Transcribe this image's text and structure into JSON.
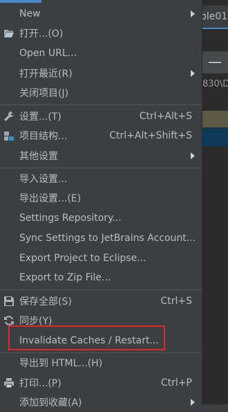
{
  "background": {
    "tab_label": "ple01",
    "path_fragment": "830\\D"
  },
  "menu": {
    "items": [
      {
        "label": "New",
        "shortcut": "",
        "submenu": true
      },
      {
        "label": "打开...(O)",
        "shortcut": "",
        "submenu": false,
        "icon": "folder-open-icon"
      },
      {
        "label": "Open URL...",
        "shortcut": "",
        "submenu": false
      },
      {
        "label": "打开最近(R)",
        "shortcut": "",
        "submenu": true
      },
      {
        "label": "关闭项目(J)",
        "shortcut": "",
        "submenu": false
      },
      {
        "label": "设置...(T)",
        "shortcut": "Ctrl+Alt+S",
        "submenu": false,
        "icon": "wrench-icon"
      },
      {
        "label": "项目结构...",
        "shortcut": "Ctrl+Alt+Shift+S",
        "submenu": false,
        "icon": "project-structure-icon"
      },
      {
        "label": "其他设置",
        "shortcut": "",
        "submenu": true
      },
      {
        "label": "导入设置...",
        "shortcut": "",
        "submenu": false
      },
      {
        "label": "导出设置...(E)",
        "shortcut": "",
        "submenu": false
      },
      {
        "label": "Settings Repository...",
        "shortcut": "",
        "submenu": false
      },
      {
        "label": "Sync Settings to JetBrains Account...",
        "shortcut": "",
        "submenu": false
      },
      {
        "label": "Export Project to Eclipse...",
        "shortcut": "",
        "submenu": false
      },
      {
        "label": "Export to Zip File...",
        "shortcut": "",
        "submenu": false
      },
      {
        "label": "保存全部(S)",
        "shortcut": "Ctrl+S",
        "submenu": false,
        "icon": "save-icon"
      },
      {
        "label": "同步(Y)",
        "shortcut": "",
        "submenu": false,
        "icon": "sync-icon"
      },
      {
        "label": "Invalidate Caches / Restart...",
        "shortcut": "",
        "submenu": false,
        "highlighted": true
      },
      {
        "label": "导出到 HTML...(H)",
        "shortcut": "",
        "submenu": false
      },
      {
        "label": "打印...(P)",
        "shortcut": "Ctrl+P",
        "submenu": false,
        "icon": "print-icon"
      },
      {
        "label": "添加到收藏(A)",
        "shortcut": "",
        "submenu": true
      }
    ]
  },
  "colors": {
    "menu_bg": "#3c3f41",
    "text": "#bbbbbb",
    "highlight_border": "#e0272b",
    "separator": "#515658"
  }
}
